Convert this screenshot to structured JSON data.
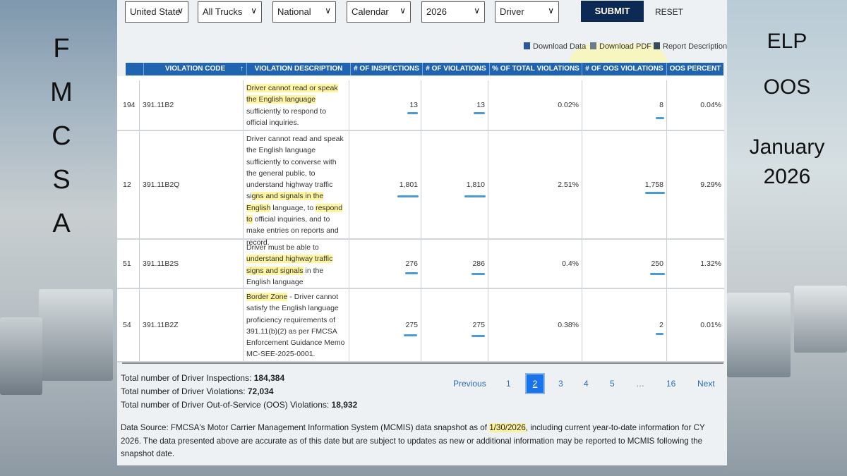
{
  "side": {
    "letters": [
      "F",
      "M",
      "C",
      "S",
      "A"
    ],
    "right": [
      "ELP",
      "OOS",
      "January",
      "2026"
    ]
  },
  "filters": {
    "country": "United States",
    "truck": "All Trucks",
    "scope": "National",
    "year_type": "Calendar",
    "year": "2026",
    "entity": "Driver",
    "submit": "SUBMIT",
    "reset": "RESET"
  },
  "downloads": {
    "data": "Download Data",
    "pdf": "Download PDF",
    "report": "Report Description"
  },
  "table": {
    "headers": [
      "VIOLATION CODE",
      "VIOLATION DESCRIPTION",
      "# OF INSPECTIONS",
      "# OF VIOLATIONS",
      "% OF TOTAL VIOLATIONS",
      "# OF OOS VIOLATIONS",
      "OOS PERCENT"
    ],
    "rows": [
      {
        "rank": "194",
        "code": "391.11B2",
        "desc_hl1": "Driver cannot read or speak the English language",
        "desc_rest": " sufficiently to respond to official inquiries.",
        "inspections": "13",
        "violations": "13",
        "pct": "0.02%",
        "oos": "8",
        "oos_pct": "0.04%"
      },
      {
        "rank": "12",
        "code": "391.11B2Q",
        "desc_a": "Driver cannot read and speak the English language sufficiently to converse with the general public, to understand highway traffic si",
        "desc_hl1": "gns and signals in the English",
        "desc_b": " language, to ",
        "desc_hl2": "respond to",
        "desc_c": " official inquiries, and to make entries on reports and record.",
        "inspections": "1,801",
        "violations": "1,810",
        "pct": "2.51%",
        "oos": "1,758",
        "oos_pct": "9.29%"
      },
      {
        "rank": "51",
        "code": "391.11B2S",
        "desc_a": "Driver must be able to ",
        "desc_hl1": "understand highway traffic signs and signals",
        "desc_b": " in the English language",
        "inspections": "276",
        "violations": "286",
        "pct": "0.4%",
        "oos": "250",
        "oos_pct": "1.32%"
      },
      {
        "rank": "54",
        "code": "391.11B2Z",
        "desc_hl1": "Border Zone",
        "desc_b": " - Driver cannot satisfy the English language proficiency requirements of 391.11(b)(2) as per FMCSA Enforcement Guidance Memo MC-SEE-2025-0001.",
        "inspections": "275",
        "violations": "275",
        "pct": "0.38%",
        "oos": "2",
        "oos_pct": "0.01%"
      }
    ]
  },
  "totals": {
    "inspections_label": "Total number of Driver Inspections: ",
    "inspections_value": "184,384",
    "violations_label": "Total number of Driver Violations: ",
    "violations_value": "72,034",
    "oos_label": "Total number of Driver Out-of-Service (OOS) Violations: ",
    "oos_value": "18,932"
  },
  "pagination": {
    "previous": "Previous",
    "pages": [
      "1",
      "2",
      "3",
      "4",
      "5",
      "…",
      "16"
    ],
    "current": "2",
    "next": "Next"
  },
  "source": {
    "a": "Data Source: FMCSA's Motor Carrier Management Information System (MCMIS) data snapshot as of ",
    "date": "1/30/2026",
    "b": ", including current year-to-date information for CY 2026. The data presented above are accurate as of this date but are subject to updates as new or additional information may be reported to MCMIS following the snapshot date."
  },
  "colors": {
    "header": "#1f63b1",
    "submit": "#0d2a55",
    "active_page": "#1a73e8",
    "highlight": "#fff078"
  }
}
